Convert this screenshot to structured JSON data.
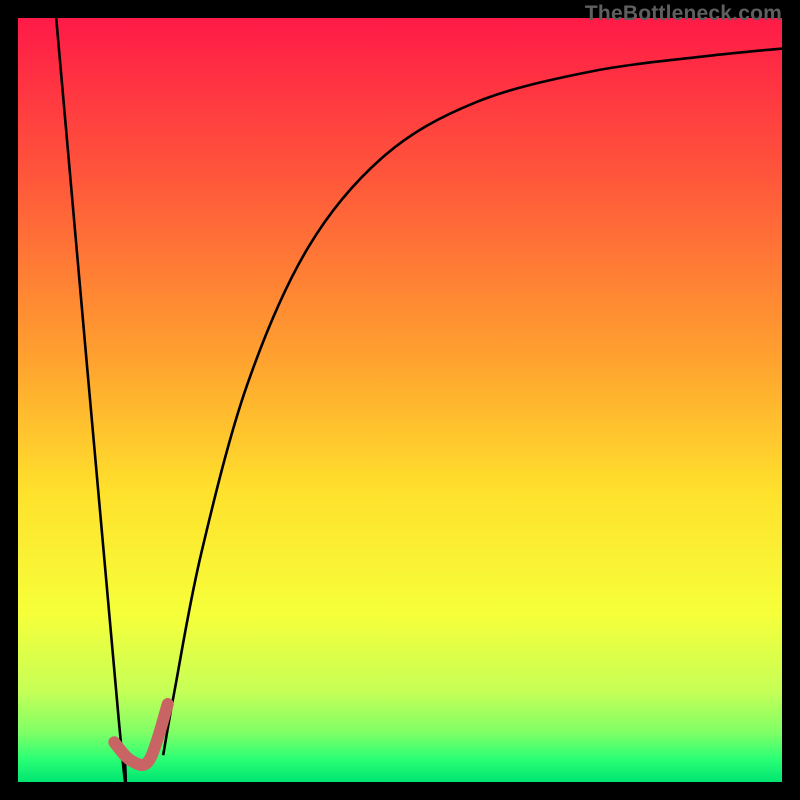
{
  "watermark": "TheBottleneck.com",
  "chart_data": {
    "type": "line",
    "title": "",
    "xlabel": "",
    "ylabel": "",
    "xlim": [
      0,
      100
    ],
    "ylim": [
      0,
      100
    ],
    "gradient_stops": [
      {
        "offset": 0.0,
        "color": "#ff1a47"
      },
      {
        "offset": 0.22,
        "color": "#ff5a3a"
      },
      {
        "offset": 0.45,
        "color": "#ffa32f"
      },
      {
        "offset": 0.62,
        "color": "#ffe12c"
      },
      {
        "offset": 0.78,
        "color": "#f6ff3a"
      },
      {
        "offset": 0.88,
        "color": "#c7ff56"
      },
      {
        "offset": 0.935,
        "color": "#80ff66"
      },
      {
        "offset": 0.97,
        "color": "#2bff74"
      },
      {
        "offset": 1.0,
        "color": "#00e572"
      }
    ],
    "series": [
      {
        "name": "left-branch",
        "stroke": "#000000",
        "width": 2.6,
        "points": [
          {
            "x": 5.0,
            "y": 100.0
          },
          {
            "x": 13.2,
            "y": 8.0
          },
          {
            "x": 14.0,
            "y": 3.5
          }
        ]
      },
      {
        "name": "right-branch",
        "stroke": "#000000",
        "width": 2.6,
        "points": [
          {
            "x": 19.0,
            "y": 3.5
          },
          {
            "x": 20.5,
            "y": 12.0
          },
          {
            "x": 24.0,
            "y": 30.0
          },
          {
            "x": 30.0,
            "y": 52.0
          },
          {
            "x": 38.0,
            "y": 70.0
          },
          {
            "x": 48.0,
            "y": 82.0
          },
          {
            "x": 60.0,
            "y": 89.0
          },
          {
            "x": 75.0,
            "y": 93.0
          },
          {
            "x": 90.0,
            "y": 95.0
          },
          {
            "x": 100.0,
            "y": 96.0
          }
        ]
      },
      {
        "name": "check-mark",
        "stroke": "#c86464",
        "width": 12,
        "linecap": "round",
        "points": [
          {
            "x": 12.6,
            "y": 5.2
          },
          {
            "x": 14.8,
            "y": 2.8
          },
          {
            "x": 17.2,
            "y": 2.9
          },
          {
            "x": 19.6,
            "y": 10.2
          }
        ]
      }
    ]
  }
}
